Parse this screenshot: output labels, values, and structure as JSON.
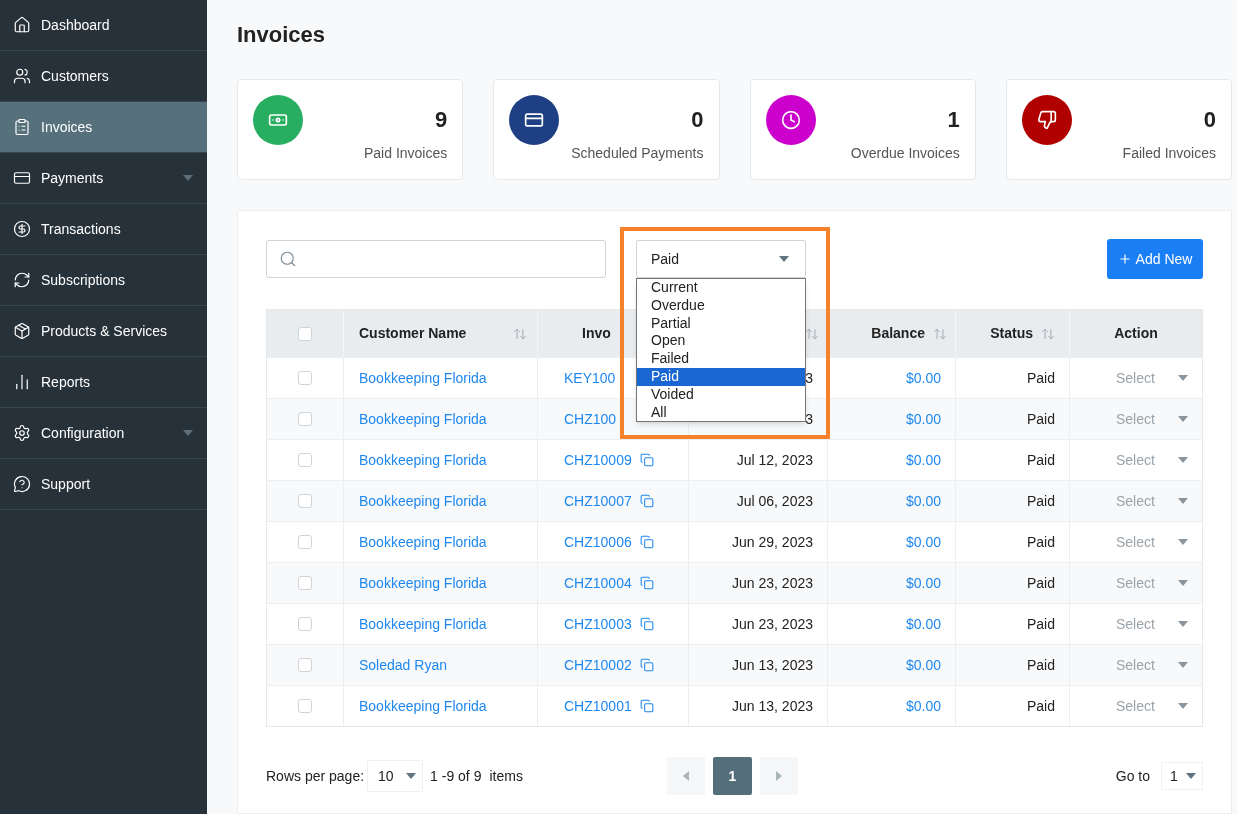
{
  "sidebar": {
    "items": [
      {
        "kind": "home",
        "label": "Dashboard",
        "selected": false,
        "expandable": false
      },
      {
        "kind": "people",
        "label": "Customers",
        "selected": false,
        "expandable": false
      },
      {
        "kind": "clipboard",
        "label": "Invoices",
        "selected": true,
        "expandable": false
      },
      {
        "kind": "card",
        "label": "Payments",
        "selected": false,
        "expandable": true
      },
      {
        "kind": "dollar",
        "label": "Transactions",
        "selected": false,
        "expandable": false
      },
      {
        "kind": "refresh",
        "label": "Subscriptions",
        "selected": false,
        "expandable": false
      },
      {
        "kind": "package",
        "label": "Products & Services",
        "selected": false,
        "expandable": false
      },
      {
        "kind": "chart",
        "label": "Reports",
        "selected": false,
        "expandable": false
      },
      {
        "kind": "gear",
        "label": "Configuration",
        "selected": false,
        "expandable": true
      },
      {
        "kind": "help",
        "label": "Support",
        "selected": false,
        "expandable": false
      }
    ]
  },
  "page_title": "Invoices",
  "stats": [
    {
      "kind": "banknote",
      "color": "#27ae60",
      "value": "9",
      "label": "Paid Invoices"
    },
    {
      "kind": "card",
      "color": "#1f3f85",
      "value": "0",
      "label": "Scheduled Payments"
    },
    {
      "kind": "clock",
      "color": "#cc00cc",
      "value": "1",
      "label": "Overdue Invoices"
    },
    {
      "kind": "thumbsdown",
      "color": "#b00000",
      "value": "0",
      "label": "Failed Invoices"
    }
  ],
  "toolbar": {
    "status_select": {
      "value": "Paid",
      "expanded": true,
      "options": [
        {
          "label": "Current",
          "selected": false
        },
        {
          "label": "Overdue",
          "selected": false
        },
        {
          "label": "Partial",
          "selected": false
        },
        {
          "label": "Open",
          "selected": false
        },
        {
          "label": "Failed",
          "selected": false
        },
        {
          "label": "Paid",
          "selected": true
        },
        {
          "label": "Voided",
          "selected": false
        },
        {
          "label": "All",
          "selected": false
        }
      ]
    },
    "add_button": {
      "label": "Add New"
    }
  },
  "table": {
    "header_checkbox": {
      "checked": false
    },
    "columns": [
      {
        "label": "Customer Name",
        "sortable": true
      },
      {
        "label": "Invo",
        "sortable": false
      },
      {
        "sortable": true
      },
      {
        "label": "Balance",
        "sortable": true
      },
      {
        "label": "Status",
        "sortable": true
      },
      {
        "label": "Action",
        "sortable": false
      }
    ],
    "rows": [
      {
        "checked": false,
        "customer": "Bookkeeping Florida",
        "invoice": "KEY100",
        "copy": false,
        "date": "3",
        "balance": "$0.00",
        "status": "Paid",
        "action": "Select"
      },
      {
        "checked": false,
        "customer": "Bookkeeping Florida",
        "invoice": "CHZ100",
        "copy": false,
        "date": "3",
        "balance": "$0.00",
        "status": "Paid",
        "action": "Select"
      },
      {
        "checked": false,
        "customer": "Bookkeeping Florida",
        "invoice": "CHZ10009",
        "copy": true,
        "date": "Jul 12, 2023",
        "balance": "$0.00",
        "status": "Paid",
        "action": "Select"
      },
      {
        "checked": false,
        "customer": "Bookkeeping Florida",
        "invoice": "CHZ10007",
        "copy": true,
        "date": "Jul 06, 2023",
        "balance": "$0.00",
        "status": "Paid",
        "action": "Select"
      },
      {
        "checked": false,
        "customer": "Bookkeeping Florida",
        "invoice": "CHZ10006",
        "copy": true,
        "date": "Jun 29, 2023",
        "balance": "$0.00",
        "status": "Paid",
        "action": "Select"
      },
      {
        "checked": false,
        "customer": "Bookkeeping Florida",
        "invoice": "CHZ10004",
        "copy": true,
        "date": "Jun 23, 2023",
        "balance": "$0.00",
        "status": "Paid",
        "action": "Select"
      },
      {
        "checked": false,
        "customer": "Bookkeeping Florida",
        "invoice": "CHZ10003",
        "copy": true,
        "date": "Jun 23, 2023",
        "balance": "$0.00",
        "status": "Paid",
        "action": "Select"
      },
      {
        "checked": false,
        "customer": "Soledad Ryan",
        "invoice": "CHZ10002",
        "copy": true,
        "date": "Jun 13, 2023",
        "balance": "$0.00",
        "status": "Paid",
        "action": "Select"
      },
      {
        "checked": false,
        "customer": "Bookkeeping Florida",
        "invoice": "CHZ10001",
        "copy": true,
        "date": "Jun 13, 2023",
        "balance": "$0.00",
        "status": "Paid",
        "action": "Select"
      }
    ]
  },
  "pagination": {
    "rows_per_page_label": "Rows per page:",
    "rows_per_page": "10",
    "range": "1 -9 of 9",
    "items_label": "items",
    "pages": [
      {
        "label": "1",
        "selected": true
      }
    ],
    "goto_label": "Go to",
    "goto_value": "1"
  }
}
